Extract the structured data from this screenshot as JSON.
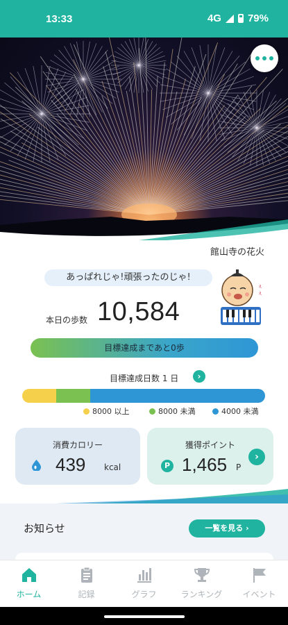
{
  "status": {
    "time": "13:33",
    "network": "4G",
    "battery": "79%"
  },
  "hero": {
    "caption": "館山寺の花火"
  },
  "speech": "あっぱれじゃ!頑張ったのじゃ!",
  "steps": {
    "label": "本日の歩数",
    "value": "10,584"
  },
  "goal": {
    "text": "目標達成まであと0歩"
  },
  "days": {
    "text": "目標達成日数 1 日"
  },
  "distribution": {
    "segments": [
      {
        "name": "8000 以上",
        "color": "#f5d04a",
        "fraction": 0.14
      },
      {
        "name": "8000 未満",
        "color": "#7ac151",
        "fraction": 0.14
      },
      {
        "name": "4000 未満",
        "color": "#2f96d6",
        "fraction": 0.72
      }
    ]
  },
  "calories": {
    "title": "消費カロリー",
    "value": "439",
    "unit": "kcal"
  },
  "points": {
    "title": "獲得ポイント",
    "value": "1,465",
    "unit": "P",
    "coin": "P"
  },
  "notice": {
    "title": "お知らせ",
    "see_all": "一覧を見る"
  },
  "tabs": [
    {
      "label": "ホーム",
      "icon": "home-icon"
    },
    {
      "label": "記録",
      "icon": "clipboard-icon"
    },
    {
      "label": "グラフ",
      "icon": "bar-chart-icon"
    },
    {
      "label": "ランキング",
      "icon": "trophy-icon"
    },
    {
      "label": "イベント",
      "icon": "flag-icon"
    }
  ],
  "colors": {
    "accent": "#1fb3a0",
    "yellow": "#f5d04a",
    "green": "#7ac151",
    "blue": "#2f96d6"
  }
}
